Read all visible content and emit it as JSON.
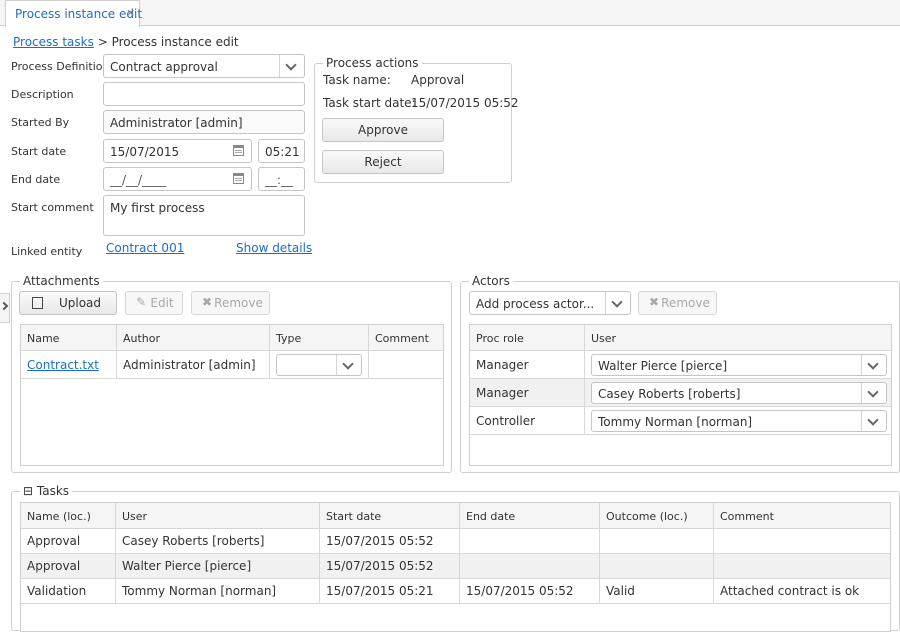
{
  "tab": {
    "label": "Process instance edit",
    "close": "×"
  },
  "breadcrumb": {
    "parent": "Process tasks",
    "separator": ">",
    "current": "Process instance edit"
  },
  "form": {
    "process_definition": {
      "label": "Process Definition",
      "value": "Contract approval"
    },
    "description": {
      "label": "Description",
      "value": ""
    },
    "started_by": {
      "label": "Started By",
      "value": "Administrator [admin]"
    },
    "start_date": {
      "label": "Start date",
      "date": "15/07/2015",
      "time": "05:21"
    },
    "end_date": {
      "label": "End date",
      "date": "__/__/____",
      "time": "__:__"
    },
    "start_comment": {
      "label": "Start comment",
      "value": "My first process"
    },
    "linked_entity": {
      "label": "Linked entity",
      "value": "Contract 001",
      "show_details": "Show details"
    }
  },
  "process_actions": {
    "legend": "Process actions",
    "task_name_label": "Task name:",
    "task_name": "Approval",
    "task_start_label": "Task start date:",
    "task_start": "15/07/2015 05:52",
    "approve": "Approve",
    "reject": "Reject"
  },
  "attachments": {
    "legend": "Attachments",
    "upload": "Upload",
    "edit": "Edit",
    "remove": "Remove",
    "columns": [
      "Name",
      "Author",
      "Type",
      "Comment"
    ],
    "rows": [
      {
        "name": "Contract.txt",
        "author": "Administrator [admin]",
        "type": "",
        "comment": ""
      }
    ]
  },
  "actors": {
    "legend": "Actors",
    "add_placeholder": "Add process actor...",
    "remove": "Remove",
    "columns": [
      "Proc role",
      "User"
    ],
    "rows": [
      {
        "role": "Manager",
        "user": "Walter Pierce [pierce]"
      },
      {
        "role": "Manager",
        "user": "Casey Roberts [roberts]"
      },
      {
        "role": "Controller",
        "user": "Tommy Norman [norman]"
      }
    ]
  },
  "tasks": {
    "legend": "Tasks",
    "collapse_symbol": "⊟",
    "columns": [
      "Name (loc.)",
      "User",
      "Start date",
      "End date",
      "Outcome (loc.)",
      "Comment"
    ],
    "rows": [
      {
        "name": "Approval",
        "user": "Casey Roberts [roberts]",
        "start": "15/07/2015 05:52",
        "end": "",
        "outcome": "",
        "comment": ""
      },
      {
        "name": "Approval",
        "user": "Walter Pierce [pierce]",
        "start": "15/07/2015 05:52",
        "end": "",
        "outcome": "",
        "comment": ""
      },
      {
        "name": "Validation",
        "user": "Tommy Norman [norman]",
        "start": "15/07/2015 05:21",
        "end": "15/07/2015 05:52",
        "outcome": "Valid",
        "comment": "Attached contract is ok"
      }
    ]
  },
  "colors": {
    "link": "#1c6fbf",
    "border": "#cfcfcf",
    "alt_row": "#f1f1f1"
  }
}
